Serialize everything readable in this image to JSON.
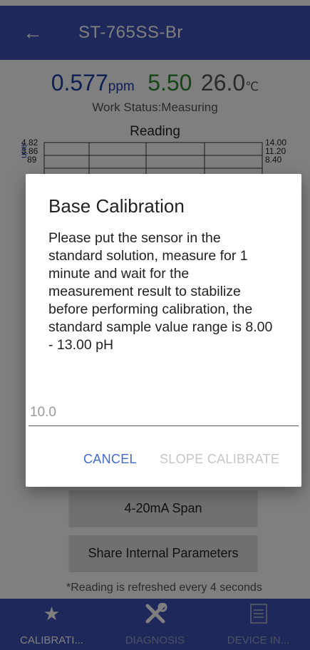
{
  "appbar": {
    "back_icon": "arrow-left-icon",
    "title": "ST-765SS-Br"
  },
  "readings": {
    "concentration": "0.577",
    "concentration_unit": "ppm",
    "ph": "5.50",
    "temperature": "26.0",
    "temperature_unit": "℃",
    "colors": {
      "concentration": "#1e3fa6",
      "ph": "#2e8b2e",
      "temperature": "#555555"
    }
  },
  "status": {
    "work_status": "Work Status:Measuring"
  },
  "chart": {
    "title": "Reading",
    "left_ticks": [
      "4.82",
      "3.86",
      "89"
    ],
    "right_ticks": [
      "14.00",
      "11.20",
      "8.40"
    ],
    "left_axis_label": "une"
  },
  "buttons": {
    "span": "4-20mA Span",
    "share": "Share Internal Parameters"
  },
  "footer_note": "*Reading is refreshed every 4 seconds",
  "bottom_nav": [
    {
      "label": "CALIBRATI...",
      "icon": "star-icon",
      "active": true
    },
    {
      "label": "DIAGNOSIS",
      "icon": "tools-icon",
      "active": false
    },
    {
      "label": "DEVICE IN...",
      "icon": "document-icon",
      "active": false
    }
  ],
  "dialog": {
    "title": "Base Calibration",
    "message": "Please put the sensor in the standard solution, measure for 1 minute and wait for the measurement result to stabilize before performing calibration, the standard sample value range is 8.00 - 13.00 pH",
    "input_placeholder": "10.0",
    "cancel_label": "CANCEL",
    "confirm_label": "SLOPE CALIBRATE"
  },
  "theme": {
    "primary": "#3f51b5",
    "accent": "#3f6bd6",
    "disabled": "#c6c6c6"
  }
}
